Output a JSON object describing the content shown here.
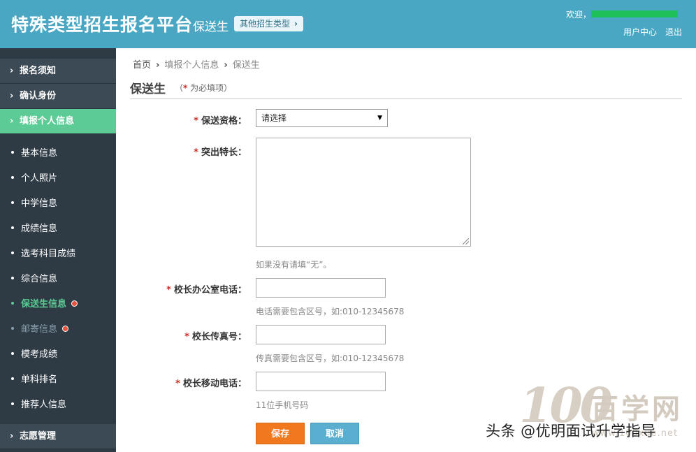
{
  "header": {
    "title": "特殊类型招生报名平台",
    "subtitle": "保送生",
    "other_types_button": "其他招生类型",
    "welcome": "欢迎，",
    "links": [
      "用户中心",
      "退出"
    ]
  },
  "sidebar": {
    "main_items": [
      "报名须知",
      "确认身份",
      "填报个人信息"
    ],
    "sub_items": [
      {
        "label": "基本信息",
        "state": "normal",
        "badge": false
      },
      {
        "label": "个人照片",
        "state": "normal",
        "badge": false
      },
      {
        "label": "中学信息",
        "state": "normal",
        "badge": false
      },
      {
        "label": "成绩信息",
        "state": "normal",
        "badge": false
      },
      {
        "label": "选考科目成绩",
        "state": "normal",
        "badge": false
      },
      {
        "label": "综合信息",
        "state": "normal",
        "badge": false
      },
      {
        "label": "保送生信息",
        "state": "active",
        "badge": true
      },
      {
        "label": "邮寄信息",
        "state": "muted",
        "badge": true
      },
      {
        "label": "模考成绩",
        "state": "normal",
        "badge": false
      },
      {
        "label": "单科排名",
        "state": "normal",
        "badge": false
      },
      {
        "label": "推荐人信息",
        "state": "normal",
        "badge": false
      }
    ],
    "bottom_item": "志愿管理"
  },
  "breadcrumb": [
    "首页",
    "填报个人信息",
    "保送生"
  ],
  "page": {
    "title": "保送生",
    "required_prefix": "（",
    "required_star": "*",
    "required_text": " 为必填项）"
  },
  "form": {
    "star": "*",
    "qualification": {
      "label": "保送资格：",
      "value": "请选择"
    },
    "specialty": {
      "label": "突出特长：",
      "hint": "如果没有请填“无”。"
    },
    "office_phone": {
      "label": "校长办公室电话：",
      "hint": "电话需要包含区号，如:010-12345678"
    },
    "fax": {
      "label": "校长传真号：",
      "hint": "传真需要包含区号，如:010-12345678"
    },
    "mobile": {
      "label": "校长移动电话：",
      "hint": "11位手机号码"
    },
    "save": "保存",
    "cancel": "取消"
  },
  "watermarks": {
    "logo_num": "100",
    "logo_cn": "百学网",
    "logo_url": "www.100xue.net",
    "caption": "头条 @优明面试升学指导"
  },
  "colors": {
    "header": "#4aa7c4",
    "sidebar": "#2e3b45",
    "accent_green": "#5ccb95",
    "required": "#c9302c",
    "save": "#f0781e",
    "cancel": "#5aaecf"
  }
}
